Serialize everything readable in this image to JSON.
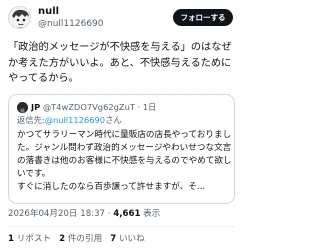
{
  "author": {
    "display_name": "null",
    "handle": "@null1126690"
  },
  "follow_button": "フォローする",
  "tweet": {
    "text": "「政治的メッセージが不快感を与える」のはなぜか考えた方がいいよ。あと、不快感与えるためにやってるから。"
  },
  "quote": {
    "name": "JP",
    "handle": "@T4wZDO7Vg62gZuT",
    "separator": "·",
    "age": "1日",
    "reply_prefix": "返信先:",
    "reply_to": "@null1126690",
    "reply_suffix": "さん",
    "body_main": "かつてサラリーマン時代に量販店の店長やっておりました。ジャンル問わず政治的メッセージやわいせつな文言の落書きは他のお客様に不快感を与えるのでやめて欲しいです。",
    "body_last": "すぐに消したのなら百歩譲って許せますが、そ..."
  },
  "meta": {
    "timestamp": "2026年04月20日 18:37",
    "separator": "·",
    "views_count": "4,661",
    "views_label": "表示"
  },
  "stats": {
    "reposts_count": "1",
    "reposts_label": "リポスト",
    "quotes_count": "2",
    "quotes_label": "件の引用",
    "likes_count": "7",
    "likes_label": "いいね"
  },
  "colors": {
    "accent": "#1d9bf0",
    "secondary_text": "#536471",
    "button_bg": "#0f1419"
  }
}
